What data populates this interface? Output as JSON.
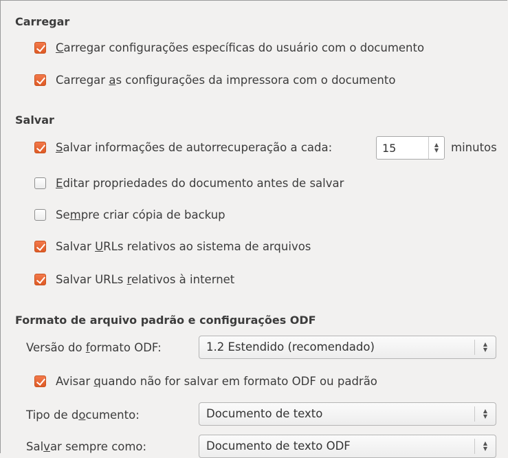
{
  "load": {
    "title": "Carregar",
    "user_settings": {
      "pre": "",
      "ul": "C",
      "post": "arregar configurações específicas do usuário com o documento",
      "checked": true
    },
    "printer_settings": {
      "pre": "Carregar ",
      "ul": "a",
      "post": "s configurações da impressora com o documento",
      "checked": true
    }
  },
  "save": {
    "title": "Salvar",
    "autorecovery": {
      "pre": "",
      "ul": "S",
      "post": "alvar informações de autorrecuperação a cada:",
      "checked": true,
      "minutes": "15",
      "unit": "minutos"
    },
    "edit_props": {
      "pre": "",
      "ul": "E",
      "post": "ditar propriedades do documento antes de salvar",
      "checked": false
    },
    "backup": {
      "pre": "Se",
      "ul": "m",
      "post": "pre criar cópia de backup",
      "checked": false
    },
    "rel_fs": {
      "pre": "Salvar ",
      "ul": "U",
      "post": "RLs relativos ao sistema de arquivos",
      "checked": true
    },
    "rel_inet": {
      "pre": "Salvar URLs ",
      "ul": "r",
      "post": "elativos à internet",
      "checked": true
    }
  },
  "odf": {
    "title": "Formato de arquivo padrão e configurações ODF",
    "version_label": {
      "pre": "Versão do ",
      "ul": "f",
      "post": "ormato ODF:"
    },
    "version_value": "1.2 Estendido (recomendado)",
    "warn": {
      "pre": "Avisar ",
      "ul": "q",
      "post": "uando não for salvar em formato ODF ou padrão",
      "checked": true
    },
    "doctype_label": {
      "pre": "Tipo de d",
      "ul": "o",
      "post": "cumento:"
    },
    "doctype_value": "Documento de texto",
    "saveas_label": {
      "pre": "Sal",
      "ul": "v",
      "post": "ar sempre como:"
    },
    "saveas_value": "Documento de texto ODF"
  },
  "colors": {
    "checkbox_checked": "#e5632d",
    "background": "#f2f1f0"
  }
}
